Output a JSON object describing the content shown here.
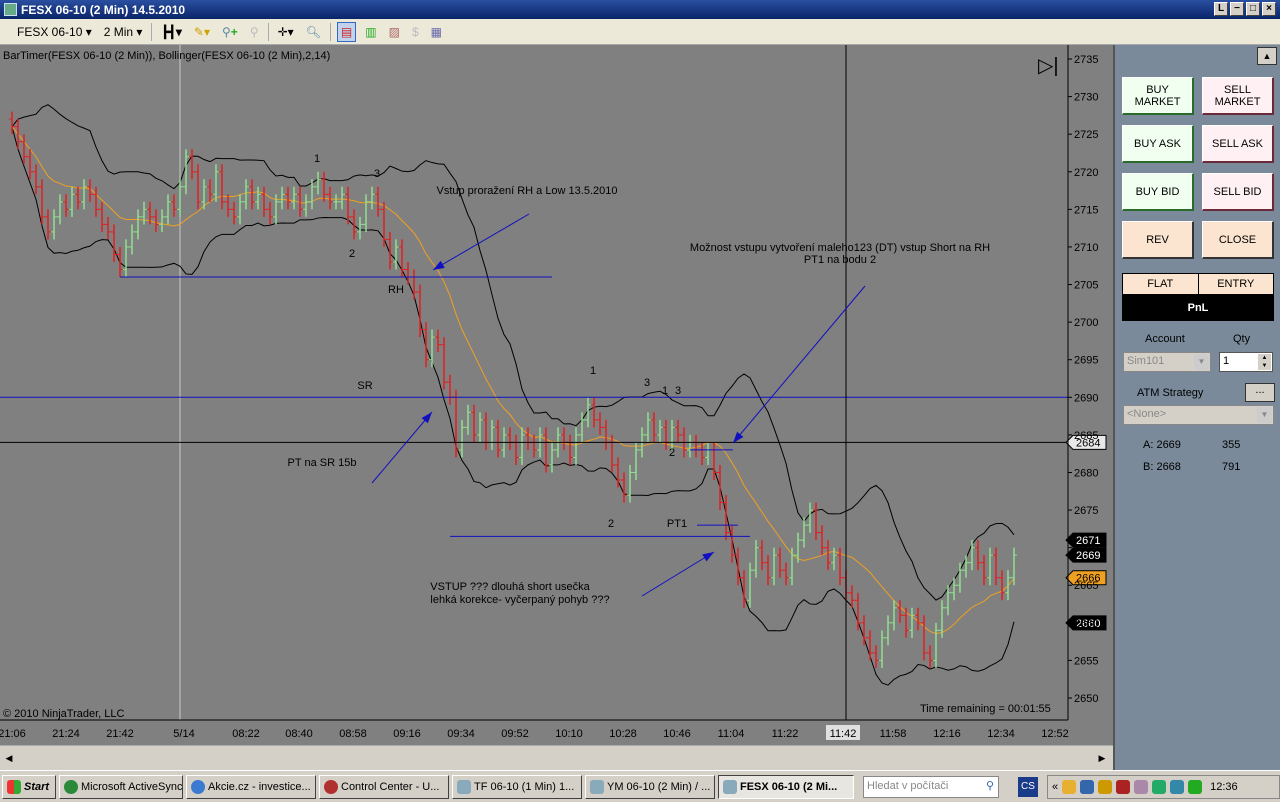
{
  "window": {
    "title": "FESX 06-10 (2 Min)  14.5.2010",
    "buttons": [
      "L",
      "−",
      "□",
      "×"
    ]
  },
  "toolbar": {
    "instrument": "FESX 06-10",
    "interval": "2 Min",
    "icons": [
      "bar-type-icon",
      "pencil-draw-icon",
      "add-indicator-icon",
      "remove-indicator-icon",
      "crosshair-icon",
      "zoom-icon",
      "chart-trader-icon",
      "candles-icon",
      "strategy-icon",
      "dollar-icon",
      "properties-icon"
    ]
  },
  "chart": {
    "indicator_label": "BarTimer(FESX 06-10 (2 Min)), Bollinger(FESX 06-10 (2 Min),2,14)",
    "copyright": "© 2010 NinjaTrader, LLC",
    "time_remaining": "Time remaining = 00:01:55",
    "crosshair_time": "11:42",
    "colors": {
      "up": "#90e090",
      "down": "#e02020",
      "bollinger": "#000000",
      "middle": "#f0a020",
      "lines": "#1010c0"
    }
  },
  "chart_data": {
    "type": "bar",
    "x_tick_labels": [
      "21:06",
      "21:24",
      "21:42",
      "5/14",
      "08:22",
      "08:40",
      "08:58",
      "09:16",
      "09:34",
      "09:52",
      "10:10",
      "10:28",
      "10:46",
      "11:04",
      "11:22",
      "11:58",
      "12:16",
      "12:34",
      "12:52"
    ],
    "y_tick_labels": [
      "2735",
      "2730",
      "2725",
      "2720",
      "2715",
      "2710",
      "2705",
      "2700",
      "2695",
      "2690",
      "2685",
      "2680",
      "2675",
      "2670",
      "2665",
      "2660",
      "2655",
      "2650"
    ],
    "ylim": [
      2650,
      2735
    ],
    "bar_interval_min": 2,
    "closes": [
      2726,
      2724,
      2722,
      2720,
      2718,
      2714,
      2712,
      2714,
      2716,
      2715,
      2717,
      2716,
      2718,
      2717,
      2715,
      2713,
      2712,
      2709,
      2707,
      2710,
      2712,
      2714,
      2715,
      2714,
      2713,
      2714,
      2716,
      2715,
      2718,
      2722,
      2720,
      2716,
      2718,
      2717,
      2720,
      2716,
      2715,
      2714,
      2716,
      2718,
      2716,
      2717,
      2715,
      2714,
      2716,
      2717,
      2716,
      2717,
      2715,
      2716,
      2718,
      2719,
      2717,
      2716,
      2716,
      2717,
      2714,
      2712,
      2713,
      2716,
      2717,
      2715,
      2711,
      2708,
      2710,
      2707,
      2706,
      2704,
      2699,
      2695,
      2698,
      2697,
      2692,
      2690,
      2683,
      2686,
      2688,
      2685,
      2687,
      2684,
      2686,
      2683,
      2685,
      2684,
      2682,
      2685,
      2684,
      2683,
      2685,
      2681,
      2683,
      2685,
      2684,
      2682,
      2685,
      2687,
      2689,
      2687,
      2686,
      2684,
      2681,
      2679,
      2677,
      2680,
      2683,
      2685,
      2687,
      2685,
      2686,
      2684,
      2686,
      2685,
      2683,
      2684,
      2683,
      2682,
      2683,
      2680,
      2676,
      2672,
      2669,
      2666,
      2663,
      2667,
      2670,
      2668,
      2666,
      2669,
      2667,
      2666,
      2669,
      2671,
      2673,
      2675,
      2672,
      2670,
      2668,
      2669,
      2666,
      2664,
      2663,
      2660,
      2658,
      2656,
      2655,
      2658,
      2660,
      2662,
      2661,
      2659,
      2661,
      2660,
      2656,
      2655,
      2659,
      2662,
      2664,
      2665,
      2667,
      2668,
      2670,
      2668,
      2666,
      2669,
      2666,
      2664,
      2666,
      2669
    ],
    "bollinger": {
      "period": 14,
      "std": 2
    },
    "price_markers": [
      {
        "value": "2684",
        "style": "crosshair"
      },
      {
        "value": "2671",
        "style": "black"
      },
      {
        "value": "2669",
        "style": "black"
      },
      {
        "value": "2666",
        "style": "orange"
      },
      {
        "value": "2660",
        "style": "black"
      }
    ],
    "levels": [
      {
        "label": "SR",
        "price": 2690
      },
      {
        "label": "RH",
        "price": 2706
      },
      {
        "label": "",
        "price": 2671.5
      },
      {
        "label": "",
        "price": 2683
      },
      {
        "label": "PT1",
        "price": 2673
      }
    ],
    "annotations": {
      "a1": "Vstup proražení RH a Low 13.5.2010",
      "a2": "Možnost vstupu vytvoření maleho123 (DT) vstup Short  na RH",
      "a3": "PT1 na bodu 2",
      "a4": "PT na SR 15b",
      "a5": "VSTUP ??? dlouhá short usečka",
      "a6": "lehká korekce- vyčerpaný pohyb ???",
      "rh": "RH",
      "sr": "SR",
      "pt1": "PT1",
      "n1": "1",
      "n2": "2",
      "n3": "3"
    }
  },
  "panel": {
    "buy_market": "BUY\nMARKET",
    "sell_market": "SELL\nMARKET",
    "buy_ask": "BUY ASK",
    "sell_ask": "SELL ASK",
    "buy_bid": "BUY BID",
    "sell_bid": "SELL BID",
    "rev": "REV",
    "close": "CLOSE",
    "flat": "FLAT",
    "entry": "ENTRY",
    "pnl": "PnL",
    "account_label": "Account",
    "qty_label": "Qty",
    "account": "Sim101",
    "qty": "1",
    "atm_label": "ATM Strategy",
    "atm_btn": "...",
    "atm_value": "<None>",
    "ask": "A: 2669",
    "ask_size": "355",
    "bid": "B: 2668",
    "bid_size": "791"
  },
  "taskbar": {
    "start": "Start",
    "tasks": [
      "Microsoft ActiveSync",
      "Akcie.cz - investice...",
      "Control Center - U...",
      "TF 06-10 (1 Min)  1...",
      "YM 06-10 (2 Min) / ...",
      "FESX 06-10 (2 Mi..."
    ],
    "search_placeholder": "Hledat v počítači",
    "lang": "CS",
    "clock": "12:36"
  }
}
